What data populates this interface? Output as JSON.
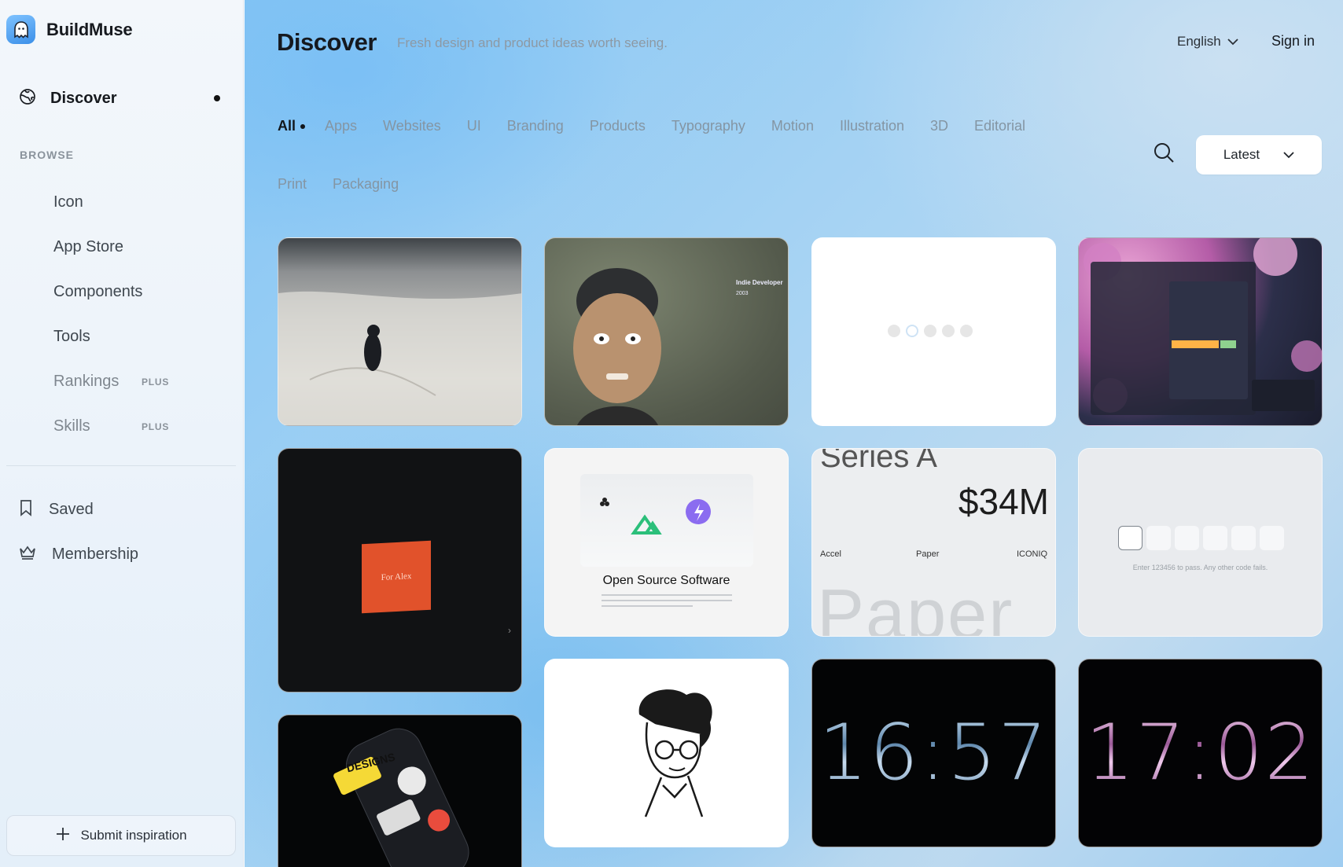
{
  "brand": {
    "name": "BuildMuse"
  },
  "sidebar": {
    "discover": {
      "label": "Discover"
    },
    "browse_heading": "BROWSE",
    "browse_items": [
      {
        "label": "Icon",
        "badge": ""
      },
      {
        "label": "App Store",
        "badge": ""
      },
      {
        "label": "Components",
        "badge": ""
      },
      {
        "label": "Tools",
        "badge": ""
      },
      {
        "label": "Rankings",
        "badge": "PLUS"
      },
      {
        "label": "Skills",
        "badge": "PLUS"
      }
    ],
    "saved": {
      "label": "Saved"
    },
    "membership": {
      "label": "Membership"
    },
    "submit": {
      "label": "Submit inspiration"
    }
  },
  "header": {
    "title": "Discover",
    "subtitle": "Fresh design and product ideas worth seeing.",
    "language": "English",
    "sign_in": "Sign in"
  },
  "tabs": [
    "All",
    "Apps",
    "Websites",
    "UI",
    "Branding",
    "Products",
    "Typography",
    "Motion",
    "Illustration",
    "3D",
    "Editorial",
    "Print",
    "Packaging"
  ],
  "active_tab": "All",
  "sort": {
    "selected": "Latest"
  },
  "cards": {
    "face": {
      "tag": "Indie Developer",
      "sub": "2003"
    },
    "open_source": {
      "title": "Open Source Software"
    },
    "series": {
      "headline": "Series A",
      "amount": "$34M",
      "brand1": "Accel",
      "brand2": "Paper",
      "brand3": "ICONIQ",
      "big": "Paper"
    },
    "otp": {
      "hint": "Enter 123456 to pass. Any other code fails."
    },
    "envelope": {
      "text": "For Alex"
    },
    "sticker": {
      "text": "DESIGNS"
    },
    "clock_blue": {
      "time": "16:57"
    },
    "clock_pink": {
      "time": "17:02"
    }
  },
  "colors": {
    "accent": "#3b8fe8",
    "text": "#16191e",
    "muted": "#8495a3"
  }
}
